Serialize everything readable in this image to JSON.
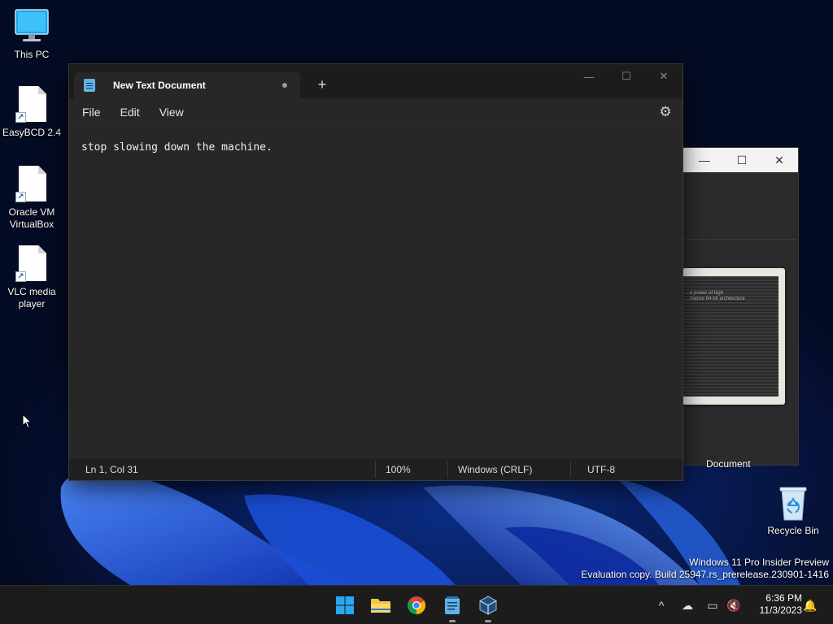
{
  "desktop": {
    "icons": [
      {
        "label": "This PC"
      },
      {
        "label": "EasyBCD 2.4"
      },
      {
        "label": "Oracle VM VirtualBox"
      },
      {
        "label": "VLC media player"
      },
      {
        "label": "Recycle Bin"
      }
    ],
    "background_window_label": "Document",
    "background_window_preview_lines": [
      "...e power of high",
      "...mance 64-bit architecture"
    ]
  },
  "notepad": {
    "tab_title": "New Text Document",
    "new_tab_symbol": "+",
    "menu": {
      "file": "File",
      "edit": "Edit",
      "view": "View"
    },
    "content": "stop slowing down the machine.",
    "status": {
      "position": "Ln 1, Col 31",
      "zoom": "100%",
      "line_ending": "Windows (CRLF)",
      "encoding": "UTF-8"
    }
  },
  "watermark": {
    "line1": "Windows 11 Pro Insider Preview",
    "line2": "Evaluation copy. Build 25947.rs_prerelease.230901-1416"
  },
  "taskbar": {
    "apps": [
      "start-icon",
      "file-explorer-icon",
      "chrome-icon",
      "notepad-icon",
      "virtualbox-icon"
    ],
    "clock": {
      "time": "6:36 PM",
      "date": "11/3/2023"
    }
  },
  "colors": {
    "accent": "#0078d4",
    "editor_bg": "#272727",
    "titlebar_bg": "#1c1c1c",
    "taskbar_bg": "#1c1c1c"
  }
}
